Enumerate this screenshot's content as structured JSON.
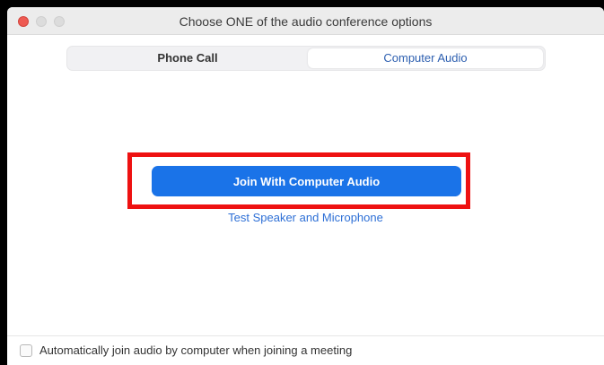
{
  "window": {
    "title": "Choose ONE of the audio conference options"
  },
  "tabs": [
    {
      "label": "Phone Call",
      "selected": false
    },
    {
      "label": "Computer Audio",
      "selected": true
    }
  ],
  "main": {
    "join_button_label": "Join With Computer Audio",
    "test_link_label": "Test Speaker and Microphone"
  },
  "footer": {
    "auto_join_label": "Automatically join audio by computer when joining a meeting",
    "auto_join_checked": false
  },
  "colors": {
    "accent": "#1a73e8",
    "highlight": "#ee1111",
    "link": "#2d6fd6"
  }
}
